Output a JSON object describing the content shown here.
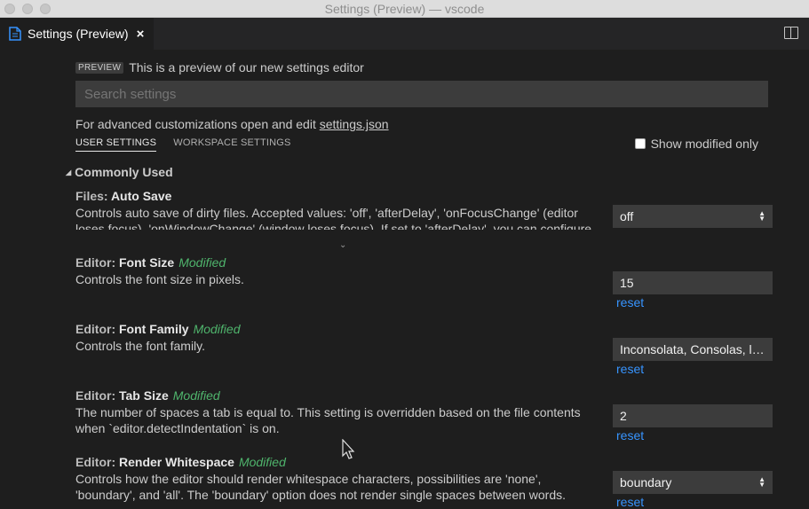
{
  "window": {
    "title": "Settings (Preview) — vscode"
  },
  "tab": {
    "label": "Settings (Preview)",
    "close": "×"
  },
  "banner": {
    "badge": "PREVIEW",
    "text": "This is a preview of our new settings editor"
  },
  "search": {
    "placeholder": "Search settings"
  },
  "advanced": {
    "prefix": "For advanced customizations open and edit ",
    "link": "settings.json"
  },
  "scope_tabs": {
    "user": "USER SETTINGS",
    "workspace": "WORKSPACE SETTINGS"
  },
  "show_modified": {
    "label": "Show modified only",
    "checked": false
  },
  "group": {
    "title": "Commonly Used"
  },
  "settings": [
    {
      "category": "Files: ",
      "key": "Auto Save",
      "modified": "",
      "description": "Controls auto save of dirty files. Accepted values:  'off', 'afterDelay', 'onFocusChange' (editor loses focus), 'onWindowChange' (window loses focus). If set to 'afterDelay', you can configure",
      "value": "off",
      "reset": ""
    },
    {
      "category": "Editor: ",
      "key": "Font Size",
      "modified": "Modified",
      "description": "Controls the font size in pixels.",
      "value": "15",
      "reset": "reset"
    },
    {
      "category": "Editor: ",
      "key": "Font Family",
      "modified": "Modified",
      "description": "Controls the font family.",
      "value": "Inconsolata, Consolas, los...",
      "reset": "reset"
    },
    {
      "category": "Editor: ",
      "key": "Tab Size",
      "modified": "Modified",
      "description": "The number of spaces a tab is equal to. This setting is overridden based on the file contents when `editor.detectIndentation` is on.",
      "value": "2",
      "reset": "reset"
    },
    {
      "category": "Editor: ",
      "key": "Render Whitespace",
      "modified": "Modified",
      "description": "Controls how the editor should render whitespace characters, possibilities are 'none', 'boundary', and 'all'. The 'boundary' option does not render single spaces between words.",
      "value": "boundary",
      "reset": "reset"
    }
  ],
  "colors": {
    "modified": "#4fb46c",
    "link": "#3794ff",
    "background": "#1e1e1e"
  }
}
